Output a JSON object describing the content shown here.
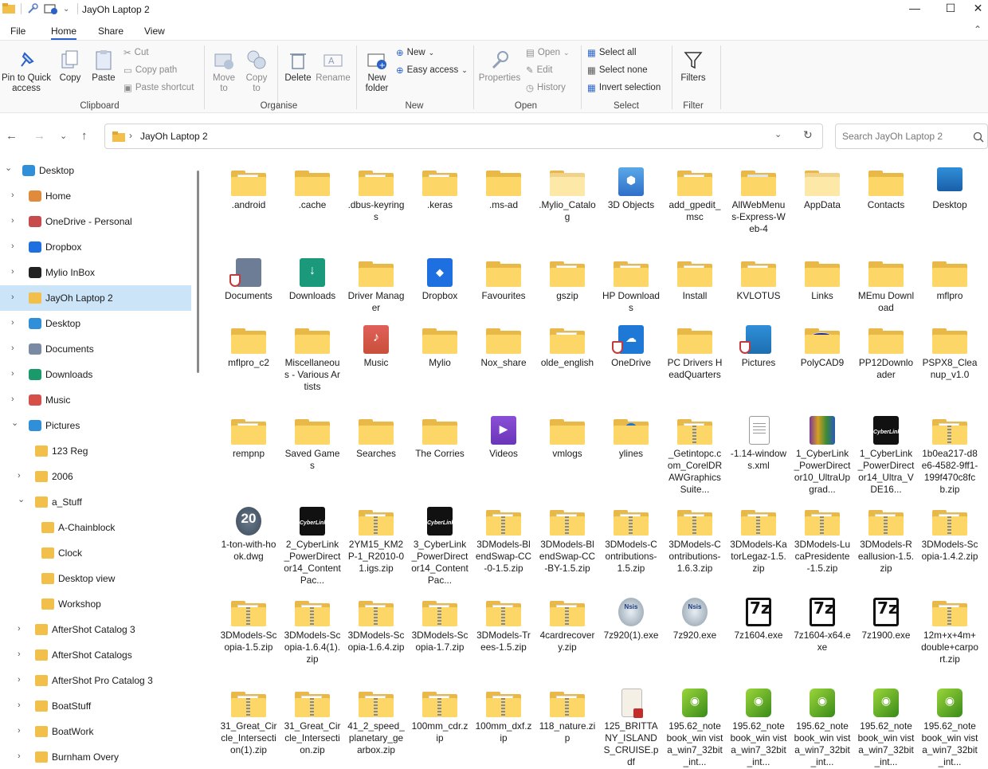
{
  "window": {
    "title": "JayOh Laptop 2",
    "controls": {
      "minimize": "—",
      "maximize": "☐",
      "close": "✕"
    }
  },
  "menu": {
    "tabs": [
      "File",
      "Home",
      "Share",
      "View"
    ],
    "active": "Home"
  },
  "ribbon": {
    "clipboard": {
      "pin": "Pin to Quick access",
      "copy": "Copy",
      "paste": "Paste",
      "cut": "Cut",
      "copy_path": "Copy path",
      "paste_shortcut": "Paste shortcut",
      "group": "Clipboard"
    },
    "organise": {
      "move_to": "Move to",
      "copy_to": "Copy to",
      "delete": "Delete",
      "rename": "Rename",
      "group": "Organise"
    },
    "new": {
      "new_folder": "New folder",
      "new_item": "New",
      "easy_access": "Easy access",
      "group": "New"
    },
    "open": {
      "properties": "Properties",
      "open": "Open",
      "edit": "Edit",
      "history": "History",
      "group": "Open"
    },
    "select": {
      "select_all": "Select all",
      "select_none": "Select none",
      "invert": "Invert selection",
      "group": "Select"
    },
    "filter": {
      "filters": "Filters",
      "group": "Filter"
    }
  },
  "address": {
    "path": "JayOh Laptop 2",
    "separator": "›",
    "search_placeholder": "Search JayOh Laptop 2"
  },
  "sidebar": {
    "items": [
      {
        "label": "Desktop",
        "icon": "desktop-icon"
      },
      {
        "label": "Home",
        "icon": "home-icon"
      },
      {
        "label": "OneDrive - Personal",
        "icon": "onedrive-icon"
      },
      {
        "label": "Dropbox",
        "icon": "dropbox-icon"
      },
      {
        "label": "Mylio InBox",
        "icon": "mylio-icon"
      },
      {
        "label": "JayOh Laptop 2",
        "icon": "folder-icon"
      },
      {
        "label": "Desktop",
        "icon": "desktop-icon"
      },
      {
        "label": "Documents",
        "icon": "documents-icon"
      },
      {
        "label": "Downloads",
        "icon": "downloads-icon"
      },
      {
        "label": "Music",
        "icon": "music-icon"
      },
      {
        "label": "Pictures",
        "icon": "pictures-icon"
      },
      {
        "label": "123 Reg",
        "icon": "folder-icon"
      },
      {
        "label": "2006",
        "icon": "folder-icon"
      },
      {
        "label": "a_Stuff",
        "icon": "folder-icon"
      },
      {
        "label": "A-Chainblock",
        "icon": "folder-icon"
      },
      {
        "label": "Clock",
        "icon": "folder-icon"
      },
      {
        "label": "Desktop view",
        "icon": "folder-icon"
      },
      {
        "label": "Workshop",
        "icon": "folder-icon"
      },
      {
        "label": "AfterShot Catalog 3",
        "icon": "folder-icon"
      },
      {
        "label": "AfterShot Catalogs",
        "icon": "folder-icon"
      },
      {
        "label": "AfterShot Pro Catalog 3",
        "icon": "folder-icon"
      },
      {
        "label": "BoatStuff",
        "icon": "folder-icon"
      },
      {
        "label": "BoatWork",
        "icon": "folder-icon"
      },
      {
        "label": "Burnham Overy",
        "icon": "folder-icon"
      }
    ]
  },
  "files": [
    [
      ".android",
      ".cache",
      ".dbus-keyrings",
      ".keras",
      ".ms-ad",
      ".Mylio_Catalog",
      "3D Objects",
      "add_gpedit_msc",
      "AllWebMenus-Express-Web-4",
      "AppData",
      "Contacts",
      "Desktop"
    ],
    [
      "Documents",
      "Downloads",
      "Driver Manager",
      "Dropbox",
      "Favourites",
      "gszip",
      "HP Downloads",
      "Install",
      "KVLOTUS",
      "Links",
      "MEmu Download",
      "mflpro"
    ],
    [
      "mflpro_c2",
      "Miscellaneous - Various Artists",
      "Music",
      "Mylio",
      "Nox_share",
      "olde_english",
      "OneDrive",
      "PC Drivers HeadQuarters",
      "Pictures",
      "PolyCAD9",
      "PP12Downloader",
      "PSPX8_Cleanup_v1.0"
    ],
    [
      "rempnp",
      "Saved Games",
      "Searches",
      "The Corries",
      "Videos",
      "vmlogs",
      "ylines",
      "_Getintopc.com_CorelDRAWGraphicsSuite...",
      "-1.14-windows.xml",
      "1_CyberLink_PowerDirector10_UltraUpgrad...",
      "1_CyberLink_PowerDirector14_Ultra_VDE16...",
      "1b0ea217-d8e6-4582-9ff1-199f470c8fcb.zip"
    ],
    [
      "1-ton-with-hook.dwg",
      "2_CyberLink_PowerDirector14_ContentPac...",
      "2YM15_KM2P-1_R2010-01.igs.zip",
      "3_CyberLink_PowerDirector14_ContentPac...",
      "3DModels-BlendSwap-CC-0-1.5.zip",
      "3DModels-BlendSwap-CC-BY-1.5.zip",
      "3DModels-Contributions-1.5.zip",
      "3DModels-Contributions-1.6.3.zip",
      "3DModels-KatorLegaz-1.5.zip",
      "3DModels-LucaPresidente-1.5.zip",
      "3DModels-Reallusion-1.5.zip",
      "3DModels-Scopia-1.4.2.zip"
    ],
    [
      "3DModels-Scopia-1.5.zip",
      "3DModels-Scopia-1.6.4(1).zip",
      "3DModels-Scopia-1.6.4.zip",
      "3DModels-Scopia-1.7.zip",
      "3DModels-Trees-1.5.zip",
      "4cardrecovery.zip",
      "7z920(1).exe",
      "7z920.exe",
      "7z1604.exe",
      "7z1604-x64.exe",
      "7z1900.exe",
      "12m+x+4m+double+carport.zip"
    ],
    [
      "31_Great_Circle_Intersection(1).zip",
      "31_Great_Circle_Intersection.zip",
      "41_2_speed_planetary_gearbox.zip",
      "100mm_cdr.zip",
      "100mm_dxf.zip",
      "118_nature.zip",
      "125_BRITTANY_ISLANDS_CRUISE.pdf",
      "195.62_notebook_win vista_win7_32bit_int...",
      "195.62_notebook_win vista_win7_32bit_int...",
      "195.62_notebook_win vista_win7_32bit_int...",
      "195.62_notebook_win vista_win7_32bit_int...",
      "195.62_notebook_win vista_win7_32bit_int..."
    ]
  ],
  "icon_kinds": [
    [
      "folder-doc",
      "folder",
      "folder-doc",
      "folder-doc",
      "folder",
      "folder-light",
      "3dobjects",
      "folder-doc",
      "folder-img",
      "folder-light",
      "folder",
      "desktop"
    ],
    [
      "documents",
      "downloads",
      "folder",
      "dropbox",
      "folder",
      "folder-doc",
      "folder-doc",
      "folder-doc",
      "folder-doc",
      "folder",
      "folder",
      "folder"
    ],
    [
      "folder",
      "folder",
      "music",
      "folder",
      "folder",
      "folder-doc",
      "onedrive",
      "folder",
      "pictures",
      "polycad",
      "folder",
      "folder"
    ],
    [
      "folder-doc",
      "folder",
      "folder",
      "folder",
      "videos",
      "folder",
      "ylines",
      "zip",
      "xml",
      "winrar",
      "cyberlink",
      "zip"
    ],
    [
      "dwg",
      "cyberlink",
      "zip",
      "cyberlink",
      "zip",
      "zip",
      "zip",
      "zip",
      "zip",
      "zip",
      "zip",
      "zip"
    ],
    [
      "zip",
      "zip",
      "zip",
      "zip",
      "zip",
      "zip",
      "nsis",
      "nsis",
      "sevenzip",
      "sevenzip",
      "sevenzip",
      "zip"
    ],
    [
      "zip",
      "zip",
      "zip",
      "zip",
      "zip",
      "zip",
      "pdf",
      "nvidia",
      "nvidia",
      "nvidia",
      "nvidia",
      "nvidia"
    ]
  ]
}
